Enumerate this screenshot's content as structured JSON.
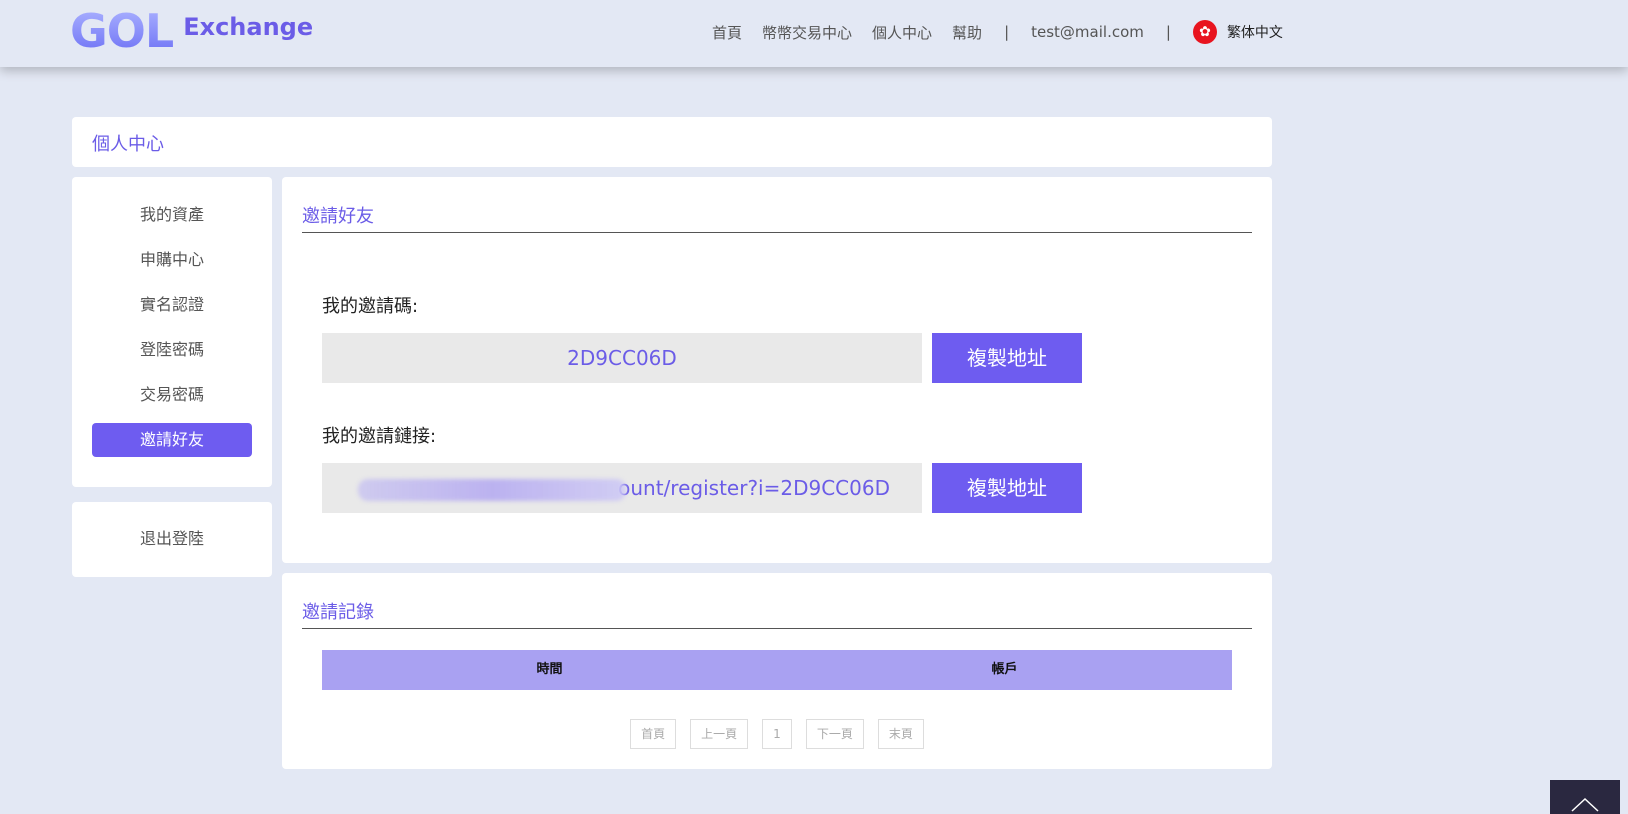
{
  "brand": {
    "logo_mark": "GOL",
    "name": "Exchange"
  },
  "nav": {
    "home": "首頁",
    "trade_center": "幣幣交易中心",
    "personal_center": "個人中心",
    "help": "幫助",
    "separator": "|",
    "email": "test@mail.com",
    "language": "繁体中文",
    "language_icon": "hong-kong-flag-icon"
  },
  "breadcrumb": {
    "title": "個人中心"
  },
  "sidebar": {
    "items": [
      {
        "label": "我的資產",
        "active": false
      },
      {
        "label": "申購中心",
        "active": false
      },
      {
        "label": "實名認證",
        "active": false
      },
      {
        "label": "登陸密碼",
        "active": false
      },
      {
        "label": "交易密碼",
        "active": false
      },
      {
        "label": "邀請好友",
        "active": true
      }
    ],
    "logout": "退出登陸"
  },
  "invite": {
    "title": "邀請好友",
    "code_label": "我的邀請碼:",
    "code_value": "2D9CC06D",
    "copy_label": "複製地址",
    "link_label": "我的邀請鏈接:",
    "link_value": "ount/register?i=2D9CC06D"
  },
  "records": {
    "title": "邀請記錄",
    "columns": [
      "時間",
      "帳戶"
    ],
    "rows": [],
    "pager": {
      "first": "首頁",
      "prev": "上一頁",
      "current": "1",
      "next": "下一頁",
      "last": "末頁"
    }
  },
  "colors": {
    "accent": "#6e5cf0",
    "table_header": "#a9a1f2",
    "background": "#e3e8f4"
  }
}
